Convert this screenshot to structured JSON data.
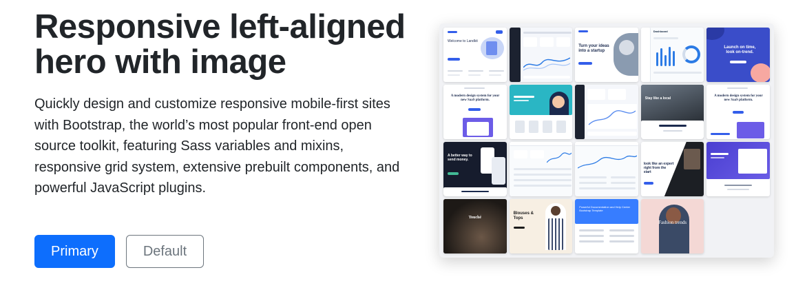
{
  "hero": {
    "title": "Responsive left-aligned hero with image",
    "lead": "Quickly design and customize responsive mobile-first sites with Bootstrap, the world’s most popular front-end open source toolkit, featuring Sass variables and mixins, responsive grid system, extensive prebuilt components, and powerful JavaScript plugins.",
    "primary_button": "Primary",
    "default_button": "Default"
  },
  "collage": {
    "tiles": [
      {
        "caption": "Welcome to Landkit"
      },
      {
        "caption": ""
      },
      {
        "caption": "Turn your ideas into a startup"
      },
      {
        "caption": "Dashboard"
      },
      {
        "caption": ""
      },
      {
        "caption": "Launch on time, look on-trend."
      },
      {
        "caption": "A modern design system for your new SaaS platform."
      },
      {
        "caption": ""
      },
      {
        "caption": ""
      },
      {
        "caption": "Stay like a local"
      },
      {
        "caption": "A modern design system for your new SaaS platform."
      },
      {
        "caption": "A better way to send money."
      },
      {
        "caption": ""
      },
      {
        "caption": ""
      },
      {
        "caption": "look like an expert right from the start"
      },
      {
        "caption": ""
      },
      {
        "caption": "Touché"
      },
      {
        "caption": "Blouses & Tops"
      },
      {
        "caption": "Powerful Documentation and Help Center Bootstrap Template"
      },
      {
        "caption": "Fashion trends"
      }
    ]
  },
  "colors": {
    "primary": "#0d6efd",
    "secondary": "#6c757d",
    "text": "#212529"
  }
}
